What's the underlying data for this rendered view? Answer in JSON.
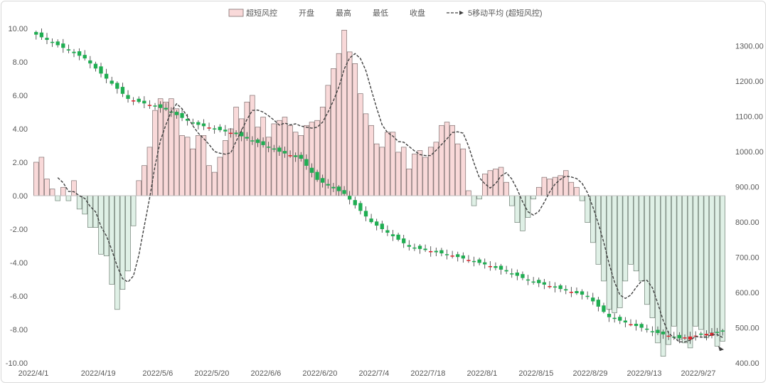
{
  "chart_data": {
    "type": "bar",
    "combo": "bar + candlestick + line",
    "legend_position": "top",
    "grid": false,
    "colors": {
      "bar_positive_fill": "#f9d9d9",
      "bar_positive_edge": "#7f6f6f",
      "bar_negative_fill": "#dff0e6",
      "bar_negative_edge": "#6f7f74",
      "candle_up": "#e0242b",
      "candle_down": "#1fae52",
      "wick": "#333333",
      "ma_line": "#404040",
      "axis_text": "#595959"
    },
    "legend": [
      {
        "key": "bar",
        "label": "超短风控"
      },
      {
        "key": "open",
        "label": "开盘"
      },
      {
        "key": "high",
        "label": "最高"
      },
      {
        "key": "low",
        "label": "最低"
      },
      {
        "key": "close",
        "label": "收盘"
      },
      {
        "key": "ma",
        "label": "5移动平均 (超短风控)"
      }
    ],
    "y_left": {
      "min": -10,
      "max": 10,
      "step": 2,
      "ticks": [
        "-10.00",
        "-8.00",
        "-6.00",
        "-4.00",
        "-2.00",
        "0.00",
        "2.00",
        "4.00",
        "6.00",
        "8.00",
        "10.00"
      ]
    },
    "y_right": {
      "min": 400,
      "max": 1350,
      "ticks": [
        "400.00",
        "500.00",
        "600.00",
        "700.00",
        "800.00",
        "900.00",
        "1000.00",
        "1100.00",
        "1200.00",
        "1300.00"
      ]
    },
    "x_tick_labels": [
      "2022/4/1",
      "2022/4/19",
      "2022/5/6",
      "2022/5/20",
      "2022/6/6",
      "2022/6/20",
      "2022/7/4",
      "2022/7/18",
      "2022/8/1",
      "2022/8/15",
      "2022/8/29",
      "2022/9/13",
      "2022/9/27"
    ],
    "x_tick_index": [
      0,
      12,
      23,
      33,
      43,
      53,
      63,
      73,
      83,
      93,
      103,
      113,
      123
    ],
    "bars": [
      2.0,
      2.3,
      1.0,
      0.4,
      -0.3,
      0.5,
      -0.3,
      0.9,
      -0.8,
      -1.1,
      -1.9,
      -1.9,
      -3.5,
      -3.6,
      -5.3,
      -6.8,
      -5.6,
      -4.5,
      -1.8,
      0.9,
      1.8,
      2.9,
      5.1,
      5.8,
      5.6,
      5.8,
      5.2,
      3.6,
      3.5,
      2.8,
      3.6,
      3.6,
      1.8,
      1.4,
      2.3,
      3.3,
      4.0,
      5.3,
      4.6,
      5.6,
      6.0,
      4.1,
      4.7,
      3.5,
      4.3,
      4.5,
      4.7,
      4.2,
      3.8,
      3.6,
      4.2,
      4.4,
      4.5,
      5.3,
      6.6,
      7.6,
      8.5,
      9.9,
      8.6,
      7.9,
      6.1,
      4.9,
      4.2,
      3.1,
      2.9,
      3.8,
      3.8,
      2.6,
      2.9,
      1.6,
      2.5,
      2.7,
      2.3,
      2.9,
      3.2,
      4.2,
      4.4,
      4.2,
      3.1,
      2.8,
      0.3,
      -0.6,
      -0.2,
      1.3,
      1.5,
      1.6,
      1.7,
      0.8,
      -0.6,
      -1.6,
      -2.1,
      -1.3,
      -0.2,
      0.5,
      1.1,
      1.0,
      1.1,
      1.2,
      1.5,
      0.8,
      0.5,
      -0.3,
      -1.6,
      -2.8,
      -4.1,
      -5.1,
      -6.8,
      -7.0,
      -6.7,
      -5.1,
      -4.1,
      -4.5,
      -5.1,
      -6.5,
      -7.3,
      -8.8,
      -9.6,
      -8.9,
      -7.8,
      -8.6,
      -8.8,
      -9.1,
      -7.8,
      -8.0,
      -8.5,
      -8.2,
      -9.0,
      -8.7
    ]
  }
}
